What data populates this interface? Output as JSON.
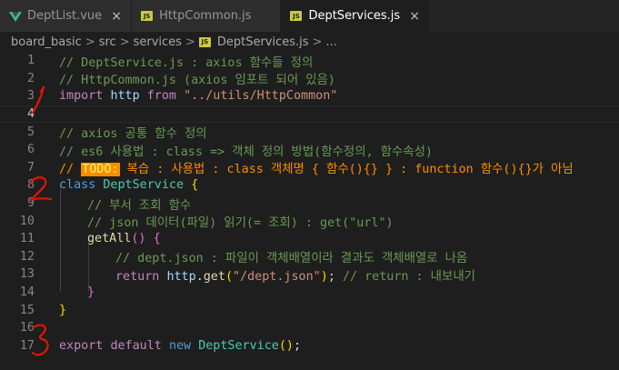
{
  "tabs": [
    {
      "label": "DeptList.vue",
      "icon": "vue-icon",
      "close": "×"
    },
    {
      "label": "HttpCommon.js",
      "icon": "js-icon",
      "icon_text": "JS",
      "close": ""
    },
    {
      "label": "DeptServices.js",
      "icon": "js-icon",
      "icon_text": "JS",
      "close": "×"
    }
  ],
  "breadcrumb": {
    "items": [
      "board_basic",
      "src",
      "services",
      "DeptServices.js",
      "..."
    ],
    "separator": ">",
    "file_icon_text": "JS"
  },
  "line_numbers": [
    "1",
    "2",
    "3",
    "4",
    "5",
    "6",
    "7",
    "8",
    "9",
    "10",
    "11",
    "12",
    "13",
    "14",
    "15",
    "16",
    "17"
  ],
  "code": {
    "l1": "// DeptService.js : axios 함수들 정의",
    "l2": "// HttpCommon.js (axios 임포트 되어 있음)",
    "l3_import": "import",
    "l3_http": "http",
    "l3_from": "from",
    "l3_str": "\"../utils/HttpCommon\"",
    "l5": "// axios 공통 함수 정의",
    "l6": "// es6 사용법 : class => 객체 정의 방법(함수정의, 함수속성)",
    "l7_slashes": "// ",
    "l7_todo": "TODO:",
    "l7_rest": " 복습 : 사용법 : class 객체명 { 함수(){} } : function 함수(){}가 아님",
    "l8_class": "class",
    "l8_name": "DeptService",
    "l8_brace": "{",
    "l9": "// 부서 조회 함수",
    "l10": "// json 데이터(파일) 읽기(= 조회) : get(\"url\")",
    "l11_fn": "getAll",
    "l11_paren": "()",
    "l11_brace": "{",
    "l12": "// dept.json : 파일이 객체배열이라 결과도 객체배열로 나옴",
    "l13_return": "return",
    "l13_http": "http",
    "l13_dot": ".",
    "l13_get": "get",
    "l13_open": "(",
    "l13_str": "\"/dept.json\"",
    "l13_close": ")",
    "l13_semi": ";",
    "l13_cm": "// return : 내보내기",
    "l14_brace": "}",
    "l15_brace": "}",
    "l17_export": "export",
    "l17_default": "default",
    "l17_new": "new",
    "l17_name": "DeptService",
    "l17_paren": "()",
    "l17_semi": ";"
  },
  "colors": {
    "background": "#1e1e1e",
    "keyword": "#569cd6",
    "control": "#c586c0",
    "string": "#ce9178",
    "comment": "#6a9955",
    "class": "#4ec9b0",
    "function": "#dcdcaa",
    "variable": "#9cdcfe",
    "todo": "#ff8c00",
    "annotation": "#e51400"
  },
  "annotations": [
    "handwritten-mark-1",
    "handwritten-mark-2",
    "handwritten-mark-3"
  ]
}
